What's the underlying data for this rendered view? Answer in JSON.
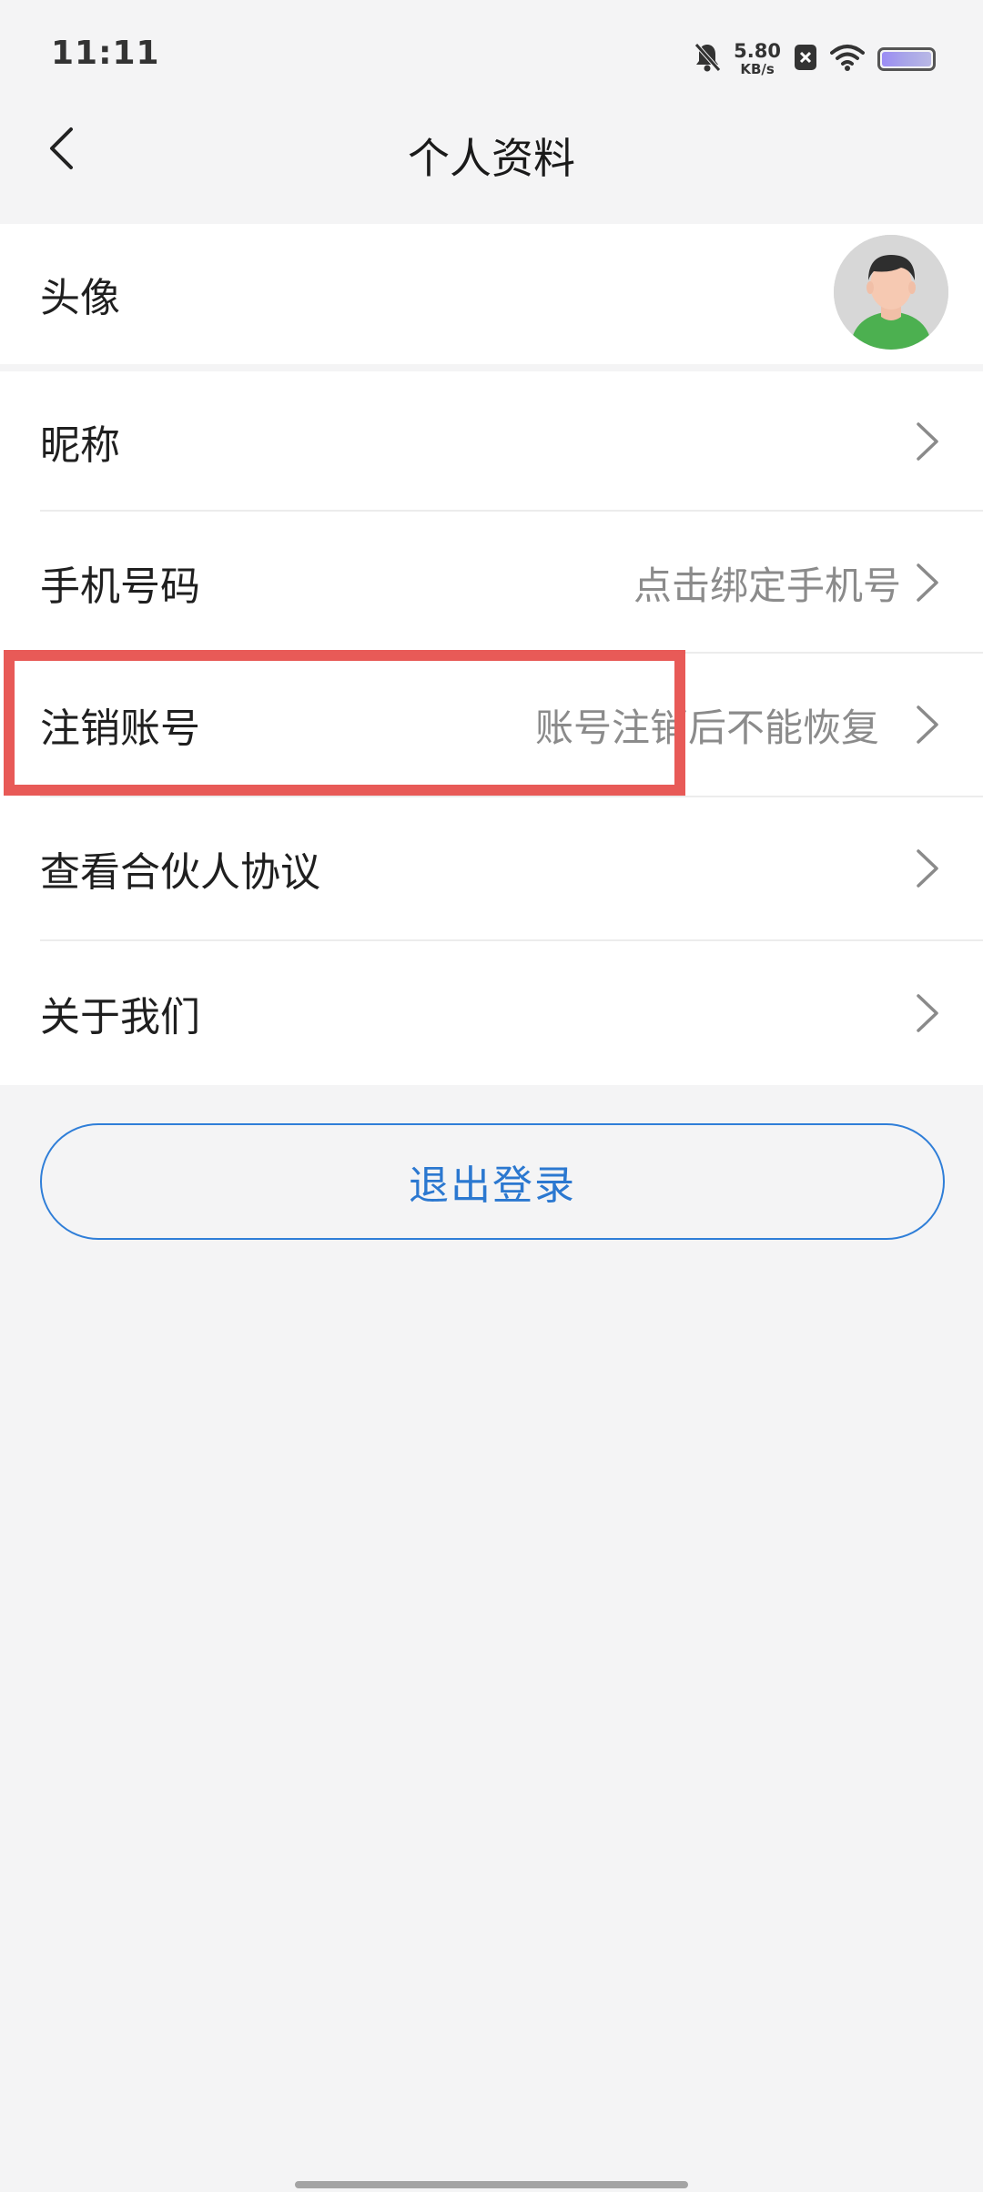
{
  "status_bar": {
    "time": "11:11",
    "net_speed_value": "5.80",
    "net_speed_unit": "KB/s",
    "icons": [
      "bell-muted-icon",
      "x-box-icon",
      "wifi-icon",
      "battery-icon"
    ]
  },
  "title_bar": {
    "title": "个人资料",
    "back_icon": "chevron-left-icon"
  },
  "rows": [
    {
      "label": "头像",
      "value": "",
      "accessory": "avatar"
    },
    {
      "label": "昵称",
      "value": "",
      "accessory": "chevron-right-icon"
    },
    {
      "label": "手机号码",
      "value": "点击绑定手机号",
      "accessory": "chevron-right-icon"
    },
    {
      "label": "注销账号",
      "value": "账号注销后不能恢复",
      "accessory": "chevron-right-icon"
    },
    {
      "label": "查看合伙人协议",
      "value": "",
      "accessory": "chevron-right-icon"
    },
    {
      "label": "关于我们",
      "value": "",
      "accessory": "chevron-right-icon"
    }
  ],
  "logout": {
    "label": "退出登录"
  },
  "colors": {
    "accent": "#2b78d0",
    "highlight": "#e85a57",
    "background": "#f4f4f5",
    "card": "#ffffff",
    "secondary_text": "#8b8b8b"
  }
}
